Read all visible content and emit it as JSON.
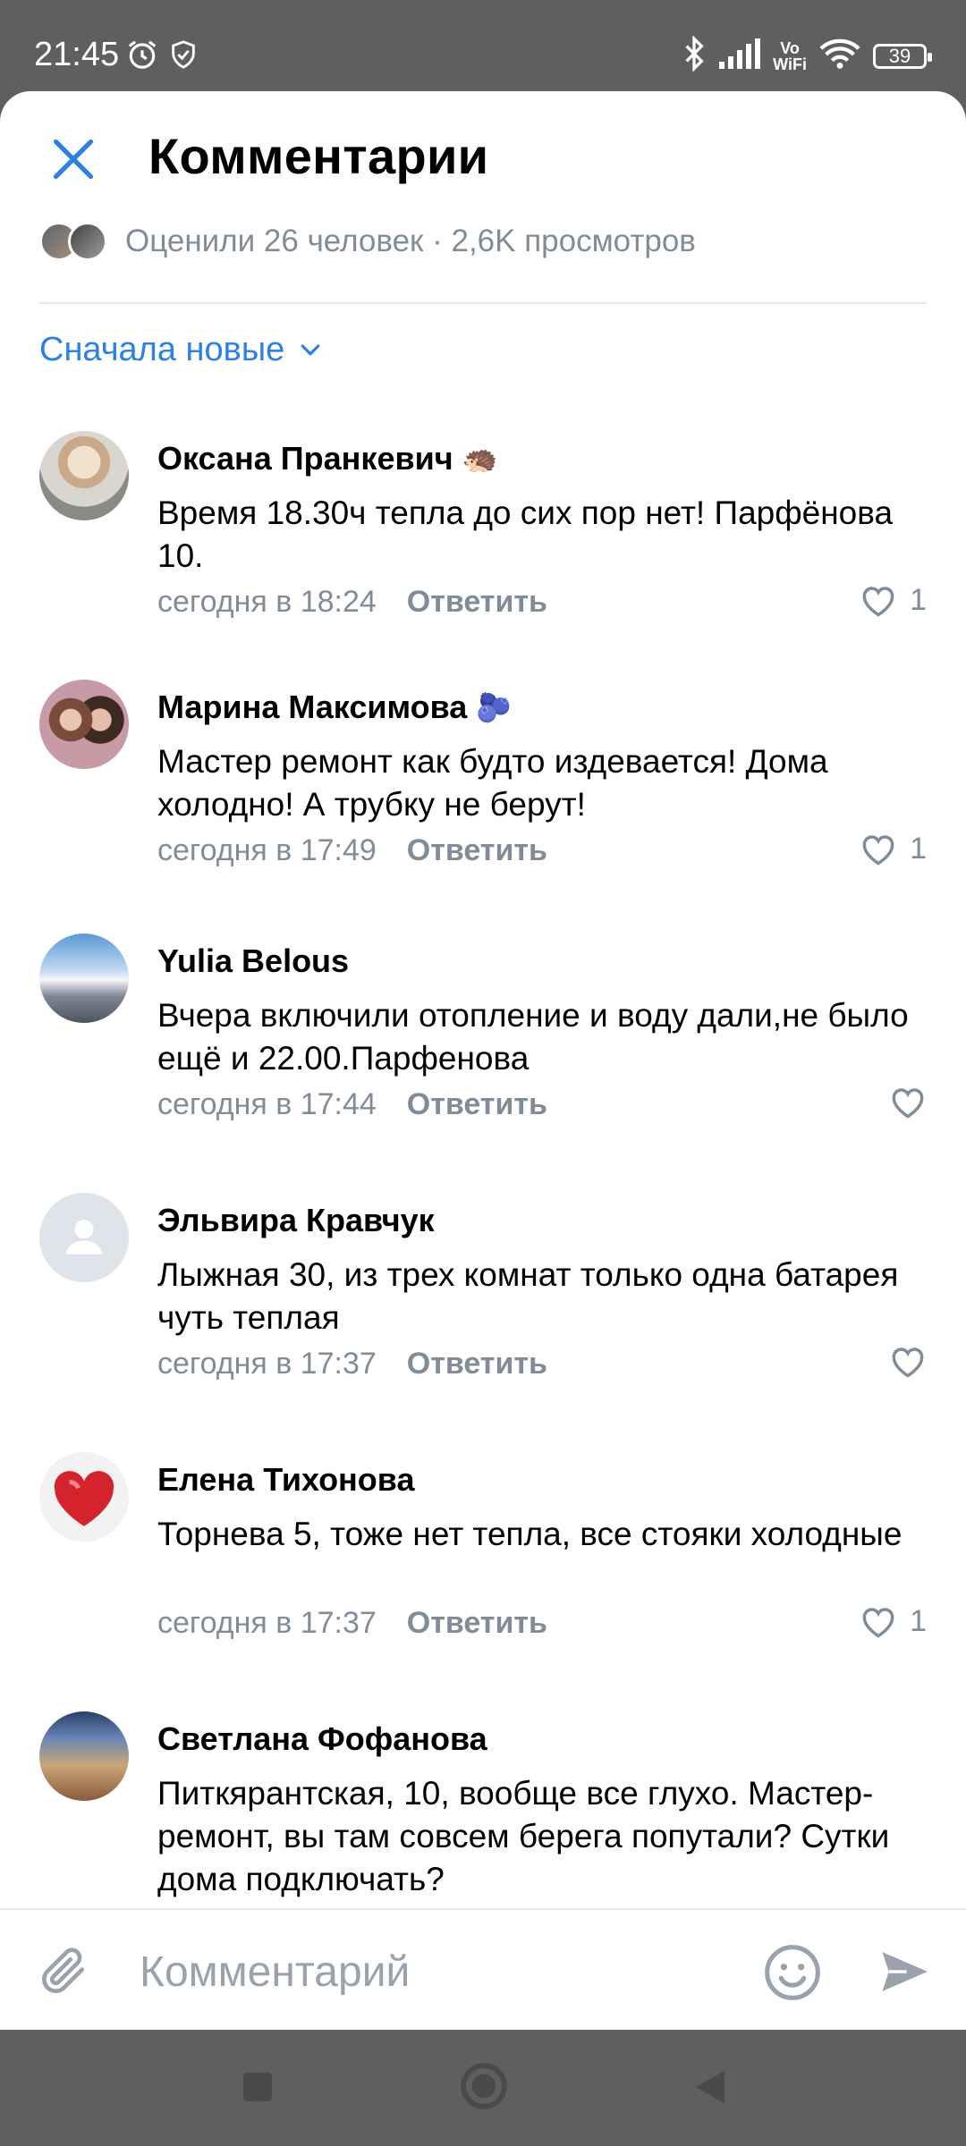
{
  "status_bar": {
    "time": "21:45",
    "vowifi_top": "Vo",
    "vowifi_bottom": "WiFi",
    "battery": "39"
  },
  "header": {
    "title": "Комментарии"
  },
  "stats": {
    "text": "Оценили 26 человек · 2,6K просмотров"
  },
  "sort": {
    "label": "Сначала новые"
  },
  "comments": [
    {
      "author": "Оксана Пранкевич",
      "emoji": "🦔",
      "text": "Время 18.30ч тепла до сих пор нет! Парфёнова 10.",
      "time": "сегодня в 18:24",
      "reply": "Ответить",
      "likes": "1"
    },
    {
      "author": "Марина Максимова",
      "emoji": "🫐",
      "text": "Мастер ремонт как будто издевается! Дома холодно! А трубку не берут!",
      "time": "сегодня в 17:49",
      "reply": "Ответить",
      "likes": "1"
    },
    {
      "author": "Yulia Belous",
      "emoji": "",
      "text": "Вчера включили  отопление и воду дали,не было ещё и 22.00.Парфенова",
      "time": "сегодня в 17:44",
      "reply": "Ответить",
      "likes": ""
    },
    {
      "author": "Эльвира Кравчук",
      "emoji": "",
      "text": "Лыжная 30, из трех комнат только одна батарея чуть теплая",
      "time": "сегодня в 17:37",
      "reply": "Ответить",
      "likes": ""
    },
    {
      "author": "Елена Тихонова",
      "emoji": "",
      "text": "Торнева 5, тоже нет тепла, все стояки холодные",
      "time": "сегодня в 17:37",
      "reply": "Ответить",
      "likes": "1"
    },
    {
      "author": "Светлана Фофанова",
      "emoji": "",
      "text": "Питкярантская, 10, вообще все глухо. Мастер-ремонт, вы там совсем берега попутали? Сутки дома подключать?",
      "time": "",
      "reply": "",
      "likes": ""
    }
  ],
  "composer": {
    "placeholder": "Комментарий"
  },
  "colors": {
    "accent": "#2d81e0",
    "secondary_text": "#818c99",
    "divider": "#e7e8ec"
  }
}
